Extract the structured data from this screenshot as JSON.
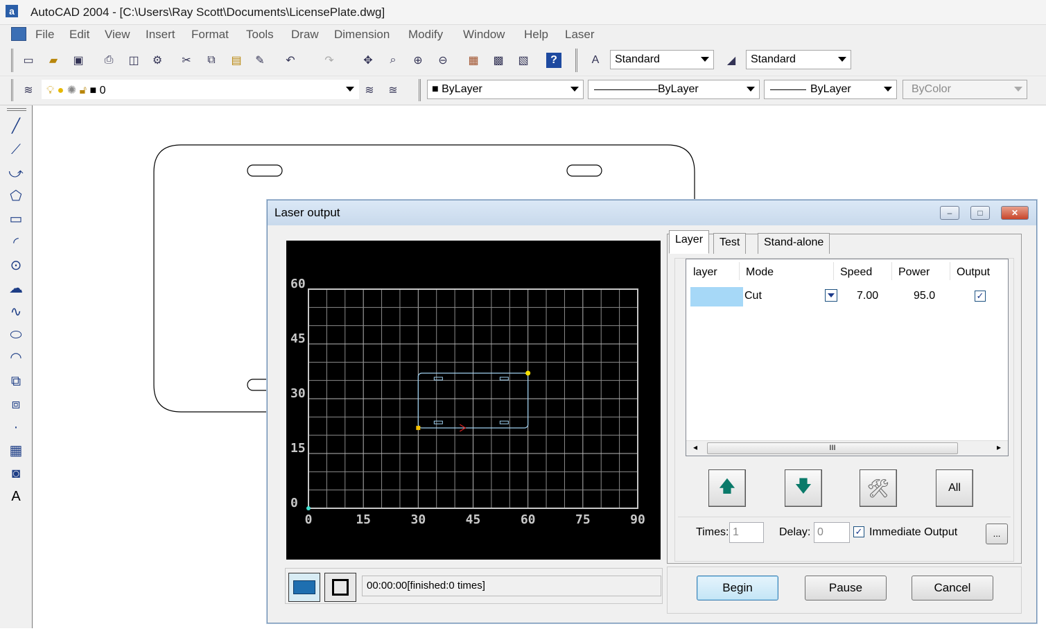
{
  "app": {
    "title": "AutoCAD 2004 - [C:\\Users\\Ray Scott\\Documents\\LicensePlate.dwg]",
    "icon_letter": "a"
  },
  "menu": [
    "File",
    "Edit",
    "View",
    "Insert",
    "Format",
    "Tools",
    "Draw",
    "Dimension",
    "Modify",
    "Window",
    "Help",
    "Laser"
  ],
  "toolbar": {
    "text_style": "Standard",
    "dim_style": "Standard",
    "layer": "0",
    "color": "ByLayer",
    "linetype": "ByLayer",
    "lineweight": "ByLayer",
    "plotstyle": "ByColor"
  },
  "dialog": {
    "title": "Laser output",
    "window_buttons": [
      "–",
      "□",
      "✕"
    ],
    "tabs": [
      "Layer",
      "Test",
      "Stand-alone"
    ],
    "active_tab": "Layer",
    "columns": [
      "layer",
      "Mode",
      "Speed",
      "Power",
      "Output"
    ],
    "rows": [
      {
        "layer_color": "#a6d8f7",
        "mode": "Cut",
        "speed": "7.00",
        "power": "95.0",
        "output": true
      }
    ],
    "scroll_label": "III",
    "all_button": "All",
    "times_label": "Times:",
    "times_value": "1",
    "delay_label": "Delay:",
    "delay_value": "0",
    "immediate_label": "Immediate Output",
    "immediate_checked": true,
    "more_button": "...",
    "status": "00:00:00[finished:0 times]",
    "begin": "Begin",
    "pause": "Pause",
    "cancel": "Cancel"
  },
  "preview_chart": {
    "x_ticks": [
      "0",
      "15",
      "30",
      "45",
      "60",
      "75",
      "90"
    ],
    "y_ticks": [
      "0",
      "15",
      "30",
      "45",
      "60"
    ],
    "xlim": [
      0,
      90
    ],
    "ylim": [
      0,
      60
    ],
    "grid": true,
    "path_color": "#9fd0f0",
    "plate_rect": {
      "x0": 30,
      "y0": 22,
      "x1": 60,
      "y1": 37
    }
  }
}
